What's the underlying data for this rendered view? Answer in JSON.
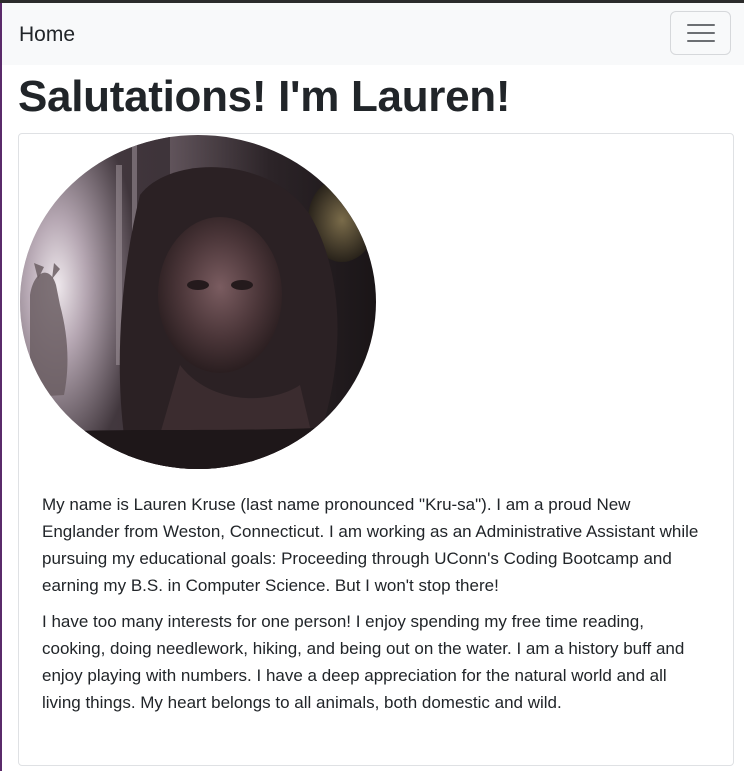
{
  "navbar": {
    "brand": "Home",
    "toggler_icon": "hamburger-menu-icon"
  },
  "page": {
    "title": "Salutations! I'm Lauren!"
  },
  "profile": {
    "photo_alt": "Lauren"
  },
  "bio": {
    "paragraphs": [
      "My name is Lauren Kruse (last name pronounced \"Kru-sa\"). I am a proud New Englander from Weston, Connecticut. I am working as an Administrative Assistant while pursuing my educational goals: Proceeding through UConn's Coding Bootcamp and earning my B.S. in Computer Science. But I won't stop there!",
      "I have too many interests for one person! I enjoy spending my free time reading, cooking, doing needlework, hiking, and being out on the water. I am a history buff and enjoy playing with numbers. I have a deep appreciation for the natural world and all living things. My heart belongs to all animals, both domestic and wild."
    ]
  },
  "colors": {
    "navbar_bg": "#f8f9fa",
    "text": "#212529",
    "card_border": "#dfe1e4"
  }
}
